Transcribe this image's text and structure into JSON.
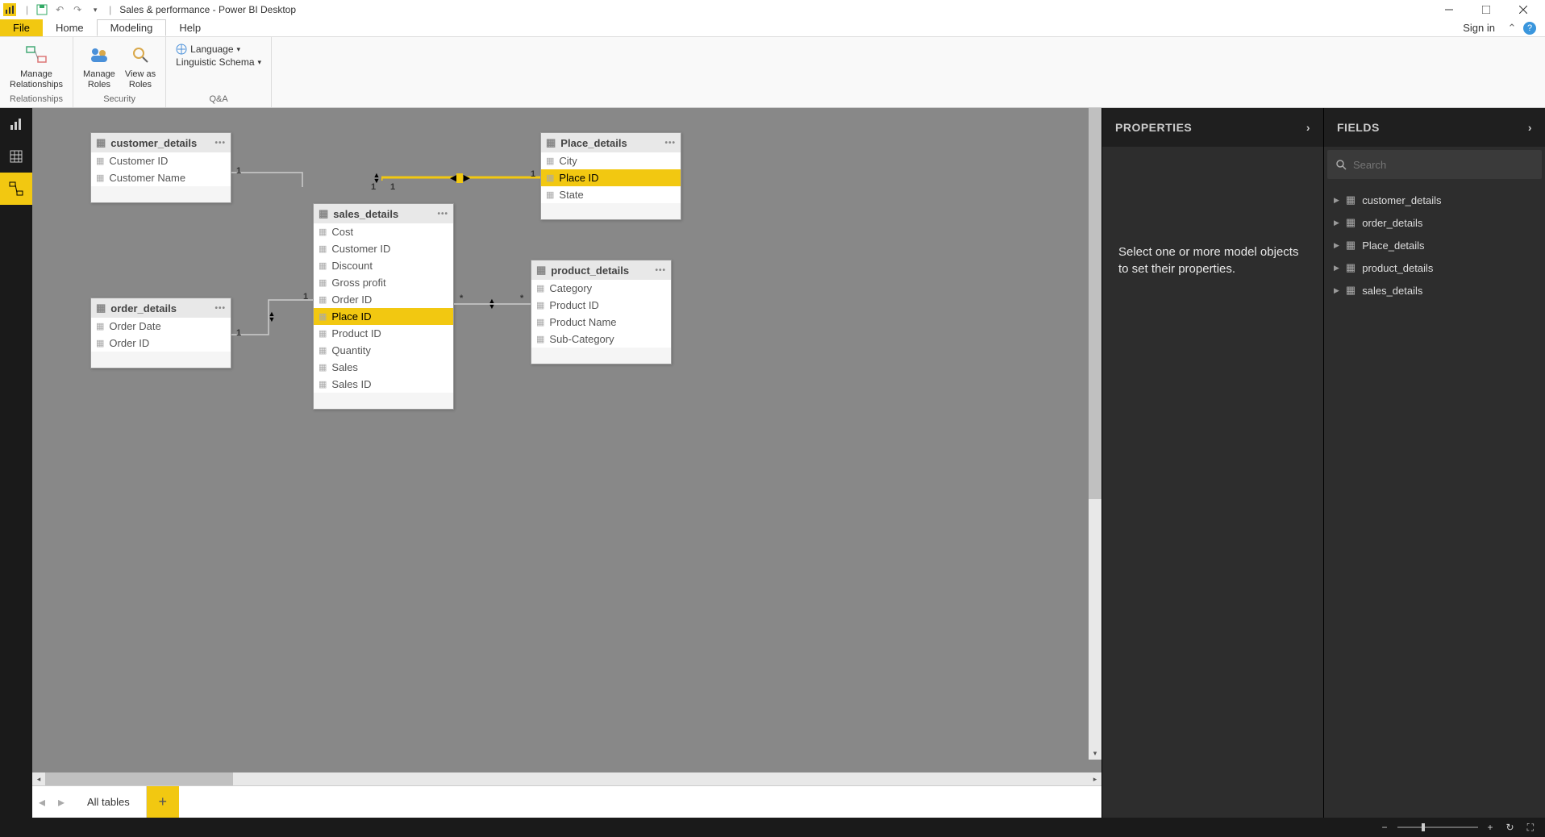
{
  "titlebar": {
    "title": "Sales & performance - Power BI Desktop"
  },
  "menu": {
    "file": "File",
    "home": "Home",
    "modeling": "Modeling",
    "help": "Help",
    "signin": "Sign in"
  },
  "ribbon": {
    "manage_relationships": "Manage\nRelationships",
    "relationships_group": "Relationships",
    "manage_roles": "Manage\nRoles",
    "view_as_roles": "View as\nRoles",
    "security_group": "Security",
    "language": "Language",
    "linguistic": "Linguistic Schema",
    "qa_group": "Q&A"
  },
  "tables": {
    "customer_details": {
      "name": "customer_details",
      "fields": [
        "Customer ID",
        "Customer Name"
      ]
    },
    "place_details": {
      "name": "Place_details",
      "fields": [
        "City",
        "Place ID",
        "State"
      ],
      "highlight": "Place ID"
    },
    "sales_details": {
      "name": "sales_details",
      "fields": [
        "Cost",
        "Customer ID",
        "Discount",
        "Gross profit",
        "Order ID",
        "Place ID",
        "Product ID",
        "Quantity",
        "Sales",
        "Sales ID"
      ],
      "highlight": "Place ID"
    },
    "order_details": {
      "name": "order_details",
      "fields": [
        "Order Date",
        "Order ID"
      ]
    },
    "product_details": {
      "name": "product_details",
      "fields": [
        "Category",
        "Product ID",
        "Product Name",
        "Sub-Category"
      ]
    }
  },
  "cardinality": {
    "one": "1",
    "many": "*"
  },
  "bottom_tabs": {
    "all_tables": "All tables"
  },
  "properties": {
    "title": "PROPERTIES",
    "placeholder": "Select one or more model objects to set their properties."
  },
  "fields": {
    "title": "FIELDS",
    "search_placeholder": "Search",
    "items": [
      "customer_details",
      "order_details",
      "Place_details",
      "product_details",
      "sales_details"
    ]
  }
}
